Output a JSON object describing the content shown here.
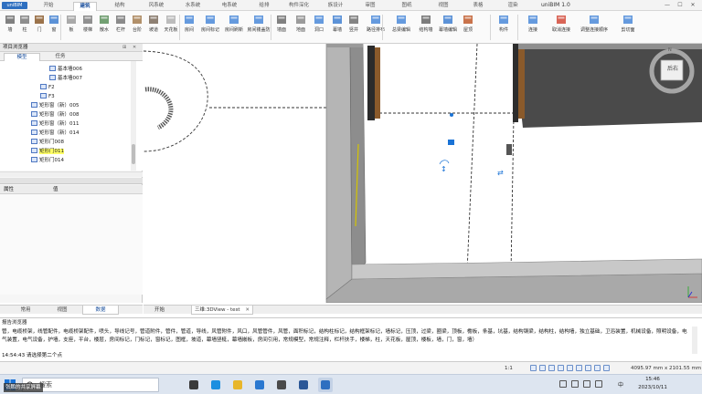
{
  "app": {
    "logo": "uniBIM",
    "title": "uniBIM 1.0",
    "tabs": [
      "开始",
      "建筑",
      "结构",
      "风系统",
      "水系统",
      "电系统",
      "给排",
      "构件深化",
      "族设计",
      "审图",
      "图纸",
      "视图",
      "表格",
      "渲染"
    ],
    "active_tab": "建筑"
  },
  "window_controls": [
    "—",
    "☐",
    "✕"
  ],
  "ribbon": {
    "buttons": [
      {
        "label": "墙",
        "icon": "wall-icon"
      },
      {
        "label": "柱",
        "icon": "column-icon"
      },
      {
        "label": "门",
        "icon": "door-icon"
      },
      {
        "label": "窗",
        "icon": "window-icon"
      },
      {
        "label": "板",
        "icon": "slab-icon"
      },
      {
        "label": "楼梯",
        "icon": "stair-icon"
      },
      {
        "label": "散水",
        "icon": "apron-icon"
      },
      {
        "label": "栏杆",
        "icon": "railing-icon"
      },
      {
        "label": "台阶",
        "icon": "step-icon"
      },
      {
        "label": "坡道",
        "icon": "ramp-icon"
      },
      {
        "label": "天花板",
        "icon": "ceiling-icon"
      },
      {
        "label": "房间",
        "icon": "room-icon"
      },
      {
        "label": "房间标记",
        "icon": "room-tag-icon"
      },
      {
        "label": "房间刷新",
        "icon": "room-refresh-icon"
      },
      {
        "label": "房间镂盖防",
        "icon": "room-cover-icon"
      },
      {
        "label": "墙面",
        "icon": "wall-face-icon"
      },
      {
        "label": "地面",
        "icon": "floor-icon"
      },
      {
        "label": "洞口",
        "icon": "opening-icon"
      },
      {
        "label": "幕墙",
        "icon": "curtain-wall-icon"
      },
      {
        "label": "竖井",
        "icon": "shaft-icon"
      },
      {
        "label": "路径排布",
        "icon": "path-layout-icon"
      },
      {
        "label": "总梁编辑",
        "icon": "beam-edit-icon"
      },
      {
        "label": "结构墙",
        "icon": "struct-wall-icon"
      },
      {
        "label": "幕墙编辑",
        "icon": "curtain-edit-icon"
      },
      {
        "label": "屋顶",
        "icon": "roof-icon"
      },
      {
        "label": "构件",
        "icon": "component-icon"
      },
      {
        "label": "连接",
        "icon": "join-icon"
      },
      {
        "label": "取消连接",
        "icon": "unjoin-icon"
      },
      {
        "label": "调整连接顺序",
        "icon": "join-order-icon"
      },
      {
        "label": "剪切面",
        "icon": "section-box-icon"
      }
    ]
  },
  "browser": {
    "title": "项目浏览器",
    "header_buttons": [
      "⊞",
      "✕"
    ],
    "tabs": [
      "模型",
      "任务"
    ],
    "active_tab": "模型",
    "items": [
      {
        "label": "基本墙006",
        "level": 5,
        "icon": "wall-item-icon",
        "selected": false
      },
      {
        "label": "基本墙007",
        "level": 5,
        "icon": "wall-item-icon",
        "selected": false
      },
      {
        "label": "F2",
        "level": 4,
        "icon": "level-icon",
        "selected": false
      },
      {
        "label": "F3",
        "level": 4,
        "icon": "level-icon",
        "selected": false
      },
      {
        "label": "矩形窗（新）005",
        "level": 3,
        "icon": "window-item-icon",
        "selected": false
      },
      {
        "label": "矩形窗（新）008",
        "level": 3,
        "icon": "window-item-icon",
        "selected": false
      },
      {
        "label": "矩形窗（新）011",
        "level": 3,
        "icon": "window-item-icon",
        "selected": false
      },
      {
        "label": "矩形窗（新）014",
        "level": 3,
        "icon": "window-item-icon",
        "selected": false
      },
      {
        "label": "矩形门008",
        "level": 3,
        "icon": "door-item-icon",
        "selected": false
      },
      {
        "label": "矩形门011",
        "level": 3,
        "icon": "door-item-icon",
        "selected": true
      },
      {
        "label": "矩形门014",
        "level": 3,
        "icon": "door-item-icon",
        "selected": false
      }
    ]
  },
  "properties": {
    "col1": "属性",
    "col2": "值"
  },
  "left_bottom_tabs": [
    "常用",
    "视图",
    "数据"
  ],
  "left_bottom_active": "数据",
  "doc_tabs": [
    "开始",
    "三维:3DView - test"
  ],
  "doc_tab_active": "三维:3DView - test",
  "doc_tab_close": "✕",
  "viewcube": {
    "face_label": "后右",
    "compass_n": "N"
  },
  "report": {
    "title": "报告浏览器",
    "text": "管，电缆桥架，线管配件，电缆桥架配件，喷头，导线记号，管道附件，管件，管道，导线，风管附件，风口，风管管件，风管，面积标记，结构柱标记，结构框架标记，墙标记，压顶，过梁，圈梁，顶板，檐板，条基，坑基，结构钢梁，结构柱，结构墙，独立基础，卫浴装置，机械设备，照明设备，电气装置，电气设备，护墙，支座，平台，楼层，房间标记，门标记，窗标记，图框，坡道，幕墙竖梃，幕墙嵌板，房间引用，常规模型，常规注释，栏杆扶手，楼梯，柱，天花板，屋顶，楼板，墙，门，窗，墙）",
    "cmd": "14:54:43   请选择第二个点"
  },
  "status_bar": {
    "scale": "1:1",
    "coords": "4095.97 mm x 2101.55 mm",
    "icon_names": [
      "snap-icon",
      "ortho-icon",
      "grid-icon",
      "polar-icon",
      "osnap-icon",
      "track-icon",
      "lineweight-icon",
      "model-icon",
      "settings-icon"
    ]
  },
  "taskbar": {
    "search_placeholder": "搜索",
    "apps": [
      "task-view-icon",
      "edge-icon",
      "file-explorer-icon",
      "mail-icon",
      "store-icon",
      "word-icon",
      "unibim-icon"
    ],
    "time": "15:46",
    "date": "2023/10/11",
    "lang": "中",
    "tray_icons": [
      "chevron-up-icon",
      "network-icon",
      "volume-icon",
      "input-icon"
    ]
  },
  "watermark": "张鹏的共享屏幕",
  "colors": {
    "accent": "#2e6fc0",
    "selection": "#ffff66",
    "wall_gray": "#a8a8a8",
    "door_brown": "#8a5a2b"
  }
}
